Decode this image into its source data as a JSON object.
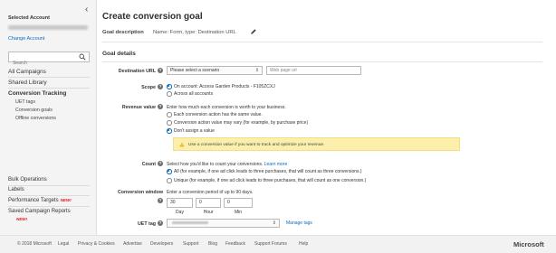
{
  "sidebar": {
    "collapse_glyph": "‹",
    "selected_account_label": "Selected Account",
    "change_account": "Change Account",
    "search_placeholder": "Search",
    "nav": {
      "all_campaigns": "All Campaigns",
      "shared_library": "Shared Library",
      "conversion_tracking": "Conversion Tracking"
    },
    "sub_items": [
      "UET tags",
      "Conversion goals",
      "Offline conversions"
    ],
    "bottom": {
      "bulk_operations": "Bulk Operations",
      "labels": "Labels",
      "performance_targets": "Performance Targets",
      "saved_campaign_reports": "Saved Campaign Reports",
      "new_badge": "NEW!"
    }
  },
  "page": {
    "title": "Create conversion goal",
    "goal_description_label": "Goal description",
    "goal_description_value": "Name: Form, type: Destination URL",
    "goal_details_title": "Goal details"
  },
  "form": {
    "destination_url": {
      "label": "Destination URL",
      "select_value": "Please select a scenario",
      "input_placeholder": "Web page url"
    },
    "scope": {
      "label": "Scope",
      "options": [
        {
          "text": "On account: Access Garden Products - F105ZCXJ",
          "selected": true
        },
        {
          "text": "Across all accounts",
          "selected": false
        }
      ]
    },
    "revenue_value": {
      "label": "Revenue value",
      "intro": "Enter how much each conversion is worth to your business.",
      "options": [
        {
          "text": "Each conversion action has the same value.",
          "selected": false
        },
        {
          "text": "Conversion action value may vary (for example, by purchase price)",
          "selected": false
        },
        {
          "text": "Don't assign a value",
          "selected": true
        }
      ],
      "warning": "Use a conversion value if you want to track and optimize your revenue."
    },
    "count": {
      "label": "Count",
      "intro": "Select how you'd like to count your conversions.",
      "learn_more": "Learn more",
      "options": [
        {
          "text": "All (for example, if one ad click leads to three purchases, that will count as three conversions.)",
          "selected": true
        },
        {
          "text": "Unique (for example, if one ad click leads to three purchases, that will count as one conversion.)",
          "selected": false
        }
      ]
    },
    "conversion_window": {
      "label": "Conversion window",
      "intro": "Enter a conversion period of up to 90 days.",
      "day_value": "30",
      "hour_value": "0",
      "min_value": "0",
      "day_label": "Day",
      "hour_label": "Hour",
      "min_label": "Min"
    },
    "uet_tag": {
      "label": "UET tag",
      "manage_tags": "Manage tags"
    },
    "help_glyph": "?"
  },
  "footer": {
    "copyright": "© 2018 Microsoft",
    "links": [
      "Legal",
      "Privacy & Cookies",
      "Advertise",
      "Developers",
      "Support",
      "Blog",
      "Feedback",
      "Support Forums",
      "Help"
    ],
    "logo": "Microsoft"
  },
  "colors": {
    "accent": "#0a6bc0",
    "warning_bg": "#fbefab",
    "new_badge": "#e81123"
  }
}
